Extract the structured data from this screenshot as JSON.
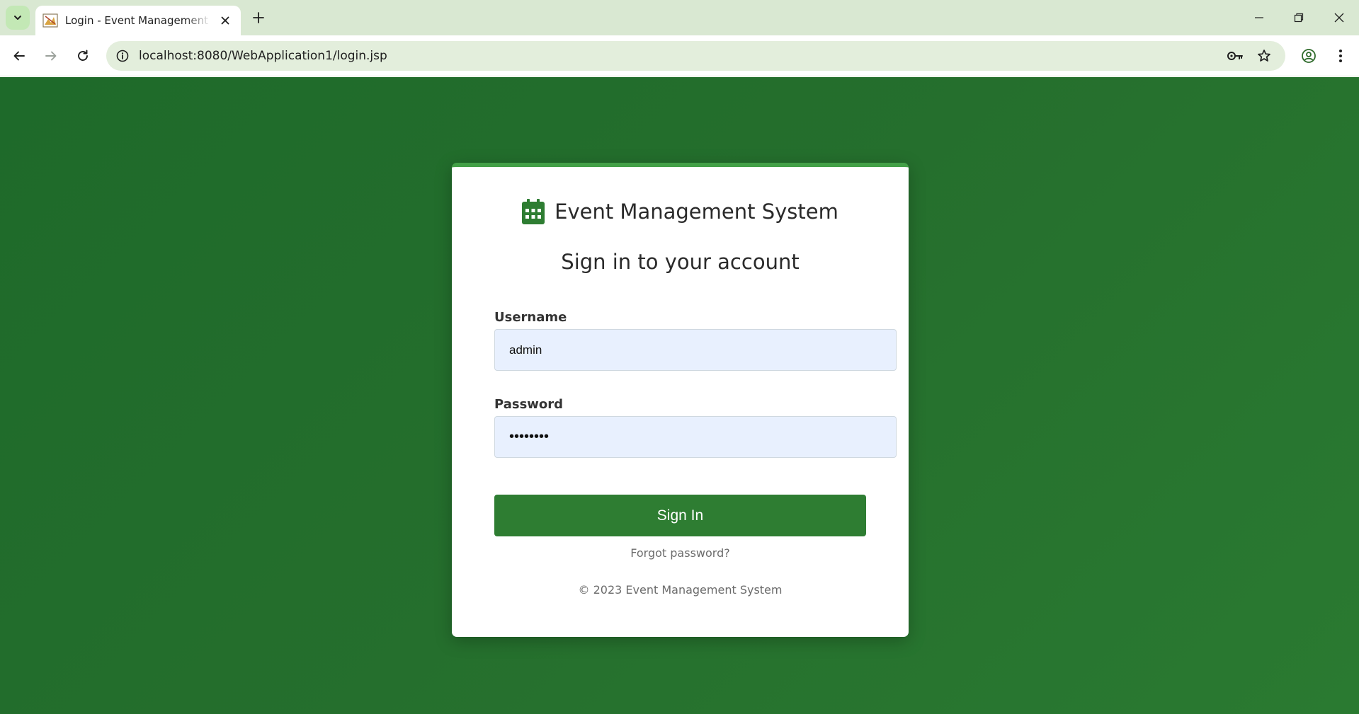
{
  "browser": {
    "tab_title": "Login - Event Management System",
    "url": "localhost:8080/WebApplication1/login.jsp"
  },
  "colors": {
    "brand_green": "#2e7d32",
    "accent_green": "#43a047",
    "page_background": "#256f2d",
    "input_background": "#e8f0fe"
  },
  "login": {
    "brand_icon": "calendar-icon",
    "brand_name": "Event Management System",
    "heading": "Sign in to your account",
    "username_label": "Username",
    "username_value": "admin",
    "password_label": "Password",
    "password_value": "••••••••",
    "submit_label": "Sign In",
    "forgot_link": "Forgot password?",
    "footer": "© 2023 Event Management System"
  }
}
